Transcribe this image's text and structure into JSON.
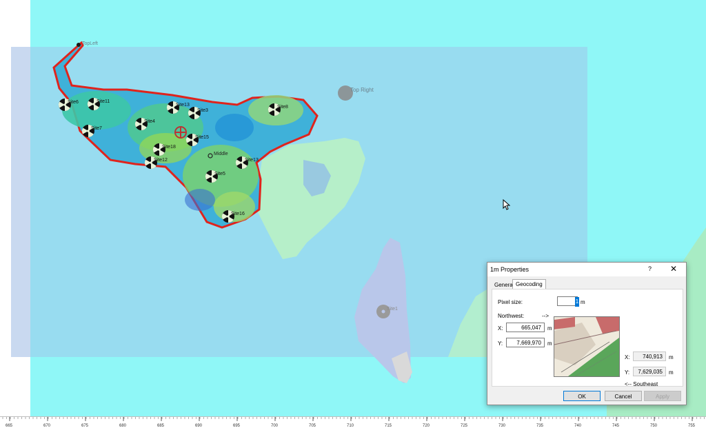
{
  "map": {
    "labels": {
      "top_left": "TopLeft",
      "top_right": "Top Right",
      "middle": "Middle"
    },
    "sites": [
      {
        "name": "Site6"
      },
      {
        "name": "Site11"
      },
      {
        "name": "Site7"
      },
      {
        "name": "Site4"
      },
      {
        "name": "Site13"
      },
      {
        "name": "Site3"
      },
      {
        "name": "Site8"
      },
      {
        "name": "Site15"
      },
      {
        "name": "Site18"
      },
      {
        "name": "Site12"
      },
      {
        "name": "Site13"
      },
      {
        "name": "Site5"
      },
      {
        "name": "Site16"
      },
      {
        "name": "Site1"
      }
    ],
    "colors": {
      "sea": "#8ff7f7",
      "overlay": "#9ad3ee",
      "coverage_outline": "#e0231c",
      "land": "#b7f0cc"
    }
  },
  "ruler": {
    "ticks": [
      "665",
      "670",
      "675",
      "680",
      "685",
      "690",
      "695",
      "700",
      "705",
      "710",
      "715",
      "720",
      "725",
      "730",
      "735",
      "740",
      "745",
      "750",
      "755"
    ]
  },
  "dialog": {
    "title": "1m Properties",
    "help": "?",
    "close": "✕",
    "tabs": [
      "General",
      "Geocoding"
    ],
    "pixel_size_label": "Pixel size:",
    "pixel_size_value": "1",
    "pixel_size_unit": "m",
    "northwest_label": "Northwest:",
    "northwest_arrow": "-->",
    "nw_x_label": "X:",
    "nw_x_value": "665,047",
    "nw_x_unit": "m",
    "nw_y_label": "Y:",
    "nw_y_value": "7,669,970",
    "nw_y_unit": "m",
    "se_x_label": "X:",
    "se_x_value": "740,913",
    "se_x_unit": "m",
    "se_y_label": "Y:",
    "se_y_value": "7,629,035",
    "se_y_unit": "m",
    "southeast_label": "<-- Southeast",
    "ok": "OK",
    "cancel": "Cancel",
    "apply": "Apply"
  }
}
